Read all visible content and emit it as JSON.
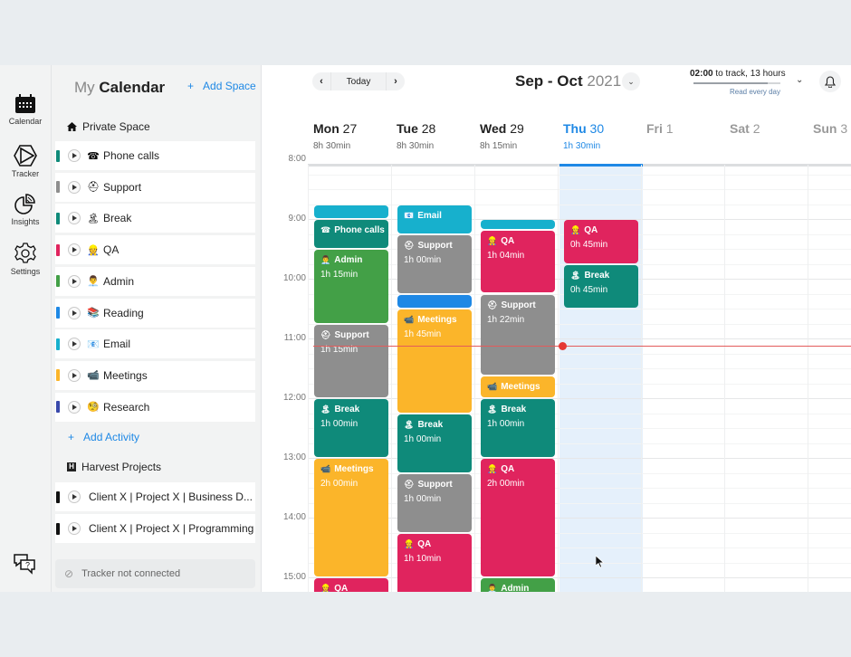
{
  "rail": {
    "items": [
      {
        "label": "Calendar",
        "icon": "calendar-icon"
      },
      {
        "label": "Tracker",
        "icon": "tracker-icon"
      },
      {
        "label": "Insights",
        "icon": "insights-icon"
      },
      {
        "label": "Settings",
        "icon": "gear-icon"
      }
    ],
    "help_icon": "help-chat-icon"
  },
  "sidebar": {
    "title_my": "My",
    "title_calendar": "Calendar",
    "add_space_plus": "+",
    "add_space_label": "Add Space",
    "private_space": {
      "icon": "home-icon",
      "label": "Private Space"
    },
    "activities": [
      {
        "name": "Phone calls",
        "emoji": "☎",
        "color": "#0f8a7a"
      },
      {
        "name": "Support",
        "emoji": "⛑",
        "color": "#8e8e8e"
      },
      {
        "name": "Break",
        "emoji": "🏝",
        "color": "#0f8a7a"
      },
      {
        "name": "QA",
        "emoji": "👷",
        "color": "#e0245e"
      },
      {
        "name": "Admin",
        "emoji": "👨‍💼",
        "color": "#43a047"
      },
      {
        "name": "Reading",
        "emoji": "📚",
        "color": "#1e88e5"
      },
      {
        "name": "Email",
        "emoji": "📧",
        "color": "#17b0cd"
      },
      {
        "name": "Meetings",
        "emoji": "📹",
        "color": "#fbb52a"
      },
      {
        "name": "Research",
        "emoji": "🧐",
        "color": "#3949ab"
      }
    ],
    "add_activity_plus": "+",
    "add_activity_label": "Add Activity",
    "harvest": {
      "badge": "H",
      "label": "Harvest Projects"
    },
    "projects": [
      {
        "name": "Client X | Project X | Business D...",
        "color": "#111111"
      },
      {
        "name": "Client X | Project X | Programming",
        "color": "#111111"
      }
    ],
    "tracker_status": "Tracker not connected"
  },
  "header": {
    "prev": "‹",
    "today": "Today",
    "next": "›",
    "period_bold": "Sep - Oct",
    "period_year": "2021",
    "track_amount": "02:00",
    "track_text": "to track, 13 hours",
    "track_progress": 0.85,
    "track_sub": "Read every day"
  },
  "days": [
    {
      "name": "Mon",
      "num": "27",
      "total": "8h 30min",
      "state": "past"
    },
    {
      "name": "Tue",
      "num": "28",
      "total": "8h 30min",
      "state": "past"
    },
    {
      "name": "Wed",
      "num": "29",
      "total": "8h 15min",
      "state": "past"
    },
    {
      "name": "Thu",
      "num": "30",
      "total": "1h 30min",
      "state": "today"
    },
    {
      "name": "Fri",
      "num": "1",
      "total": "",
      "state": "future"
    },
    {
      "name": "Sat",
      "num": "2",
      "total": "",
      "state": "future"
    },
    {
      "name": "Sun",
      "num": "3",
      "total": "",
      "state": "future"
    }
  ],
  "hours": [
    "8:00",
    "9:00",
    "10:00",
    "11:00",
    "12:00",
    "13:00",
    "14:00",
    "15:00"
  ],
  "now_time": "11:07",
  "colors": {
    "teal": "#0f8a7a",
    "gray": "#8e8e8e",
    "pink": "#e0245e",
    "green": "#43a047",
    "blue": "#1e88e5",
    "cyan": "#17b0cd",
    "yellow": "#fbb52a"
  },
  "events": [
    {
      "day": 0,
      "start": "8:45",
      "end": "9:00",
      "title": "",
      "duration": "",
      "emoji": "",
      "color": "#17b0cd"
    },
    {
      "day": 0,
      "start": "9:00",
      "end": "9:30",
      "title": "Phone calls",
      "duration": "",
      "emoji": "☎",
      "color": "#0f8a7a"
    },
    {
      "day": 0,
      "start": "9:30",
      "end": "10:45",
      "title": "Admin",
      "duration": "1h 15min",
      "emoji": "👨‍💼",
      "color": "#43a047"
    },
    {
      "day": 0,
      "start": "10:45",
      "end": "12:00",
      "title": "Support",
      "duration": "1h 15min",
      "emoji": "⛑",
      "color": "#8e8e8e"
    },
    {
      "day": 0,
      "start": "12:00",
      "end": "13:00",
      "title": "Break",
      "duration": "1h 00min",
      "emoji": "🏝",
      "color": "#0f8a7a"
    },
    {
      "day": 0,
      "start": "13:00",
      "end": "15:00",
      "title": "Meetings",
      "duration": "2h 00min",
      "emoji": "📹",
      "color": "#fbb52a"
    },
    {
      "day": 0,
      "start": "15:00",
      "end": "16:00",
      "title": "QA",
      "duration": "",
      "emoji": "👷",
      "color": "#e0245e"
    },
    {
      "day": 1,
      "start": "8:45",
      "end": "9:15",
      "title": "Email",
      "duration": "",
      "emoji": "📧",
      "color": "#17b0cd"
    },
    {
      "day": 1,
      "start": "9:15",
      "end": "10:15",
      "title": "Support",
      "duration": "1h 00min",
      "emoji": "⛑",
      "color": "#8e8e8e"
    },
    {
      "day": 1,
      "start": "10:15",
      "end": "10:30",
      "title": "",
      "duration": "",
      "emoji": "",
      "color": "#1e88e5"
    },
    {
      "day": 1,
      "start": "10:30",
      "end": "12:15",
      "title": "Meetings",
      "duration": "1h 45min",
      "emoji": "📹",
      "color": "#fbb52a"
    },
    {
      "day": 1,
      "start": "12:15",
      "end": "13:15",
      "title": "Break",
      "duration": "1h 00min",
      "emoji": "🏝",
      "color": "#0f8a7a"
    },
    {
      "day": 1,
      "start": "13:15",
      "end": "14:15",
      "title": "Support",
      "duration": "1h 00min",
      "emoji": "⛑",
      "color": "#8e8e8e"
    },
    {
      "day": 1,
      "start": "14:15",
      "end": "15:25",
      "title": "QA",
      "duration": "1h 10min",
      "emoji": "👷",
      "color": "#e0245e"
    },
    {
      "day": 2,
      "start": "9:00",
      "end": "9:11",
      "title": "",
      "duration": "",
      "emoji": "",
      "color": "#17b0cd"
    },
    {
      "day": 2,
      "start": "9:11",
      "end": "10:15",
      "title": "QA",
      "duration": "1h 04min",
      "emoji": "👷",
      "color": "#e0245e"
    },
    {
      "day": 2,
      "start": "10:15",
      "end": "11:37",
      "title": "Support",
      "duration": "1h 22min",
      "emoji": "⛑",
      "color": "#8e8e8e"
    },
    {
      "day": 2,
      "start": "11:37",
      "end": "12:00",
      "title": "Meetings",
      "duration": "",
      "emoji": "📹",
      "color": "#fbb52a"
    },
    {
      "day": 2,
      "start": "12:00",
      "end": "13:00",
      "title": "Break",
      "duration": "1h 00min",
      "emoji": "🏝",
      "color": "#0f8a7a"
    },
    {
      "day": 2,
      "start": "13:00",
      "end": "15:00",
      "title": "QA",
      "duration": "2h 00min",
      "emoji": "👷",
      "color": "#e0245e"
    },
    {
      "day": 2,
      "start": "15:00",
      "end": "16:00",
      "title": "Admin",
      "duration": "",
      "emoji": "👨‍💼",
      "color": "#43a047"
    },
    {
      "day": 3,
      "start": "9:00",
      "end": "9:45",
      "title": "QA",
      "duration": "0h 45min",
      "emoji": "👷",
      "color": "#e0245e"
    },
    {
      "day": 3,
      "start": "9:45",
      "end": "10:30",
      "title": "Break",
      "duration": "0h 45min",
      "emoji": "🏝",
      "color": "#0f8a7a"
    }
  ]
}
